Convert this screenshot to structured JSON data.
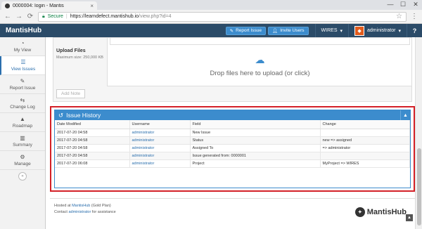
{
  "browser": {
    "tab_title": "0000004: login - Mantis",
    "secure_label": "Secure",
    "url_host": "https://learndefect.mantishub.io",
    "url_path": "/view.php?id=4",
    "controls": {
      "minimize": "—",
      "maximize": "☐",
      "close": "✕"
    },
    "nav": {
      "back": "←",
      "forward": "→",
      "reload": "⟳"
    }
  },
  "navbar": {
    "brand": "MantisHub",
    "report_issue": "Report Issue",
    "invite_users": "Invite Users",
    "project": "WIRES",
    "user": "administrator",
    "help": "?"
  },
  "sidebar": {
    "items": [
      {
        "label": "My View",
        "icon": "dashboard-icon",
        "glyph": "◔"
      },
      {
        "label": "View Issues",
        "icon": "list-icon",
        "glyph": "☰"
      },
      {
        "label": "Report Issue",
        "icon": "edit-icon",
        "glyph": "✎"
      },
      {
        "label": "Change Log",
        "icon": "retweet-icon",
        "glyph": "⇆"
      },
      {
        "label": "Roadmap",
        "icon": "road-icon",
        "glyph": "▲"
      },
      {
        "label": "Summary",
        "icon": "bar-chart-icon",
        "glyph": "▥"
      },
      {
        "label": "Manage",
        "icon": "gears-icon",
        "glyph": "⚙"
      }
    ],
    "active_index": 1,
    "collapse_glyph": "«"
  },
  "attachments": {
    "label": "Upload Files",
    "max_size": "Maximum size: 250,000 KB",
    "drop_text": "Drop files here to upload (or click)",
    "add_note": "Add Note"
  },
  "history": {
    "title": "Issue History",
    "columns": [
      "Date Modified",
      "Username",
      "Field",
      "Change"
    ],
    "rows": [
      [
        "2017-07-20 04:58",
        "administrator",
        "New Issue",
        ""
      ],
      [
        "2017-07-20 04:58",
        "administrator",
        "Status",
        "new => assigned"
      ],
      [
        "2017-07-20 04:58",
        "administrator",
        "Assigned To",
        "=> administrator"
      ],
      [
        "2017-07-20 04:58",
        "administrator",
        "Issue generated from: 0000001",
        ""
      ],
      [
        "2017-07-20 06:08",
        "administrator",
        "Project",
        "MyProject => WIRES"
      ]
    ]
  },
  "footer": {
    "hosted_prefix": "Hosted at ",
    "hosted_link": "MantisHub",
    "hosted_suffix": " (Gold Plan)",
    "contact_prefix": "Contact ",
    "contact_link": "administrator",
    "contact_suffix": " for assistance",
    "logo_text": "MantisHub"
  },
  "colors": {
    "navbar": "#2b4b68",
    "accent": "#3c8ccd",
    "highlight": "#d32027"
  }
}
